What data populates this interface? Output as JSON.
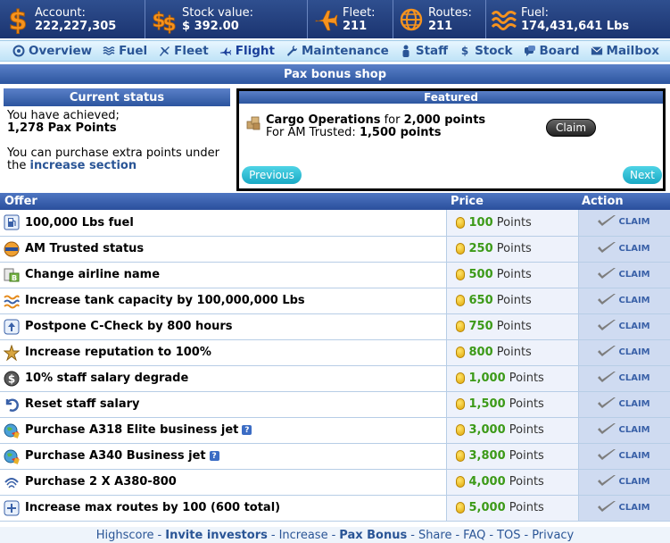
{
  "topbar": {
    "stats": [
      {
        "label": "Account:",
        "value": "222,227,305",
        "icon": "dollar-icon"
      },
      {
        "label": "Stock value:",
        "value": "$ 392.00",
        "icon": "stock-icon"
      },
      {
        "label": "Fleet:",
        "value": "211",
        "icon": "plane-icon"
      },
      {
        "label": "Routes:",
        "value": "211",
        "icon": "globe-icon"
      },
      {
        "label": "Fuel:",
        "value": "174,431,641 Lbs",
        "icon": "fuel-waves-icon"
      }
    ]
  },
  "nav": {
    "items": [
      {
        "label": "Overview",
        "icon": "overview-icon"
      },
      {
        "label": "Fuel",
        "icon": "fuel-icon"
      },
      {
        "label": "Fleet",
        "icon": "fleet-icon"
      },
      {
        "label": "Flight",
        "icon": "flight-icon"
      },
      {
        "label": "Maintenance",
        "icon": "wrench-icon"
      },
      {
        "label": "Staff",
        "icon": "staff-icon"
      },
      {
        "label": "Stock",
        "icon": "stock-dollar-icon"
      },
      {
        "label": "Board",
        "icon": "board-icon"
      },
      {
        "label": "Mailbox",
        "icon": "mail-icon"
      }
    ]
  },
  "title": "Pax bonus shop",
  "status": {
    "heading": "Current status",
    "achieved_line": "You have achieved;",
    "points": "1,278 Pax Points",
    "purchase_line": "You can purchase extra points under",
    "the_word": "the",
    "link": "increase section"
  },
  "featured": {
    "heading": "Featured",
    "item_name": "Cargo Operations",
    "for_text": " for ",
    "item_points": "2,000 points",
    "trusted_text": "For AM Trusted: ",
    "trusted_points": "1,500 points",
    "claim": "Claim",
    "previous": "Previous",
    "next": "Next"
  },
  "table": {
    "headers": {
      "offer": "Offer",
      "price": "Price",
      "action": "Action"
    },
    "points_label": "Points",
    "claim_label": "CLAIM",
    "rows": [
      {
        "offer": "100,000 Lbs fuel",
        "price": "100",
        "icon": "fuel-pump-icon",
        "help": false
      },
      {
        "offer": "AM Trusted status",
        "price": "250",
        "icon": "trusted-badge-icon",
        "help": false
      },
      {
        "offer": "Change airline name",
        "price": "500",
        "icon": "rename-icon",
        "help": false
      },
      {
        "offer": "Increase tank capacity by 100,000,000 Lbs",
        "price": "650",
        "icon": "fuel-waves-icon",
        "help": false
      },
      {
        "offer": "Postpone C-Check by 800 hours",
        "price": "750",
        "icon": "arrow-up-icon",
        "help": false
      },
      {
        "offer": "Increase reputation to 100%",
        "price": "800",
        "icon": "reputation-icon",
        "help": false
      },
      {
        "offer": "10% staff salary degrade",
        "price": "1,000",
        "icon": "dollar-coin-icon",
        "help": false
      },
      {
        "offer": "Reset staff salary",
        "price": "1,500",
        "icon": "undo-icon",
        "help": false
      },
      {
        "offer": "Purchase A318 Elite business jet",
        "price": "3,000",
        "icon": "jet-globe-icon",
        "help": true
      },
      {
        "offer": "Purchase A340 Business jet",
        "price": "3,800",
        "icon": "jet-globe-icon",
        "help": true
      },
      {
        "offer": "Purchase 2 X A380-800",
        "price": "4,000",
        "icon": "a380-icon",
        "help": false
      },
      {
        "offer": "Increase max routes by 100 (600 total)",
        "price": "5,000",
        "icon": "plus-box-icon",
        "help": false
      }
    ]
  },
  "footer": {
    "links": [
      {
        "label": "Highscore",
        "bold": false
      },
      {
        "label": "Invite investors",
        "bold": true
      },
      {
        "label": "Increase",
        "bold": false
      },
      {
        "label": "Pax Bonus",
        "bold": true
      },
      {
        "label": "Share",
        "bold": false
      },
      {
        "label": "FAQ",
        "bold": false
      },
      {
        "label": "TOS",
        "bold": false
      },
      {
        "label": "Privacy",
        "bold": false
      }
    ]
  }
}
